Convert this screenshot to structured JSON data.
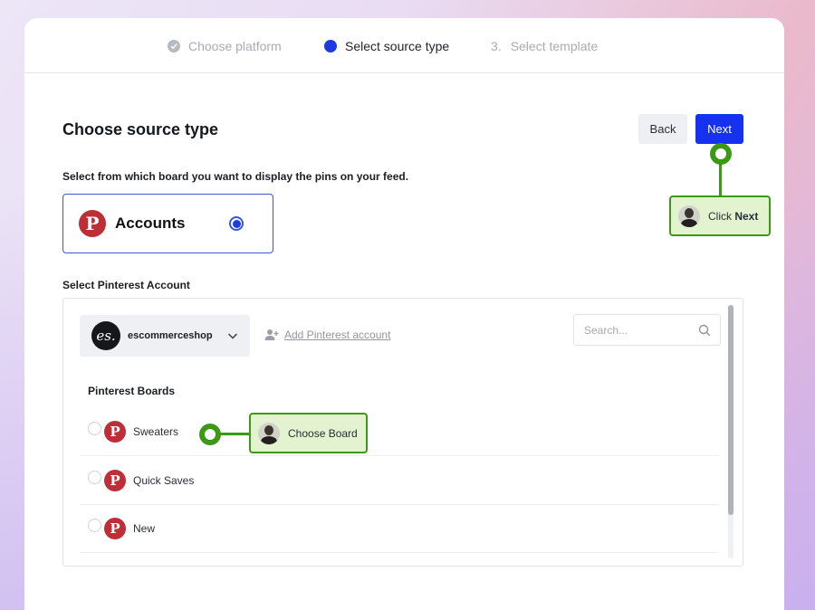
{
  "stepper": {
    "steps": [
      {
        "label": "Choose platform",
        "state": "done"
      },
      {
        "label": "Select source type",
        "state": "active"
      },
      {
        "number": "3.",
        "label": "Select template",
        "state": "pending"
      }
    ]
  },
  "header": {
    "title": "Choose source type",
    "back_label": "Back",
    "next_label": "Next"
  },
  "source": {
    "prompt": "Select from which board you want to display the pins on your feed.",
    "option_label": "Accounts",
    "option_selected": true
  },
  "account": {
    "heading": "Select Pinterest Account",
    "logo_text": "es.",
    "selected_account": "escommerceshop",
    "add_account_label": "Add Pinterest account",
    "search_placeholder": "Search..."
  },
  "boards": {
    "heading": "Pinterest Boards",
    "items": [
      {
        "name": "Sweaters",
        "selected": false
      },
      {
        "name": "Quick Saves",
        "selected": false
      },
      {
        "name": "New",
        "selected": false
      }
    ]
  },
  "callouts": {
    "next_prefix": "Click ",
    "next_bold": "Next",
    "board": "Choose Board"
  },
  "colors": {
    "accent": "#1631f0",
    "pinterest": "#bd2e36",
    "callout": "#3a9a13"
  }
}
